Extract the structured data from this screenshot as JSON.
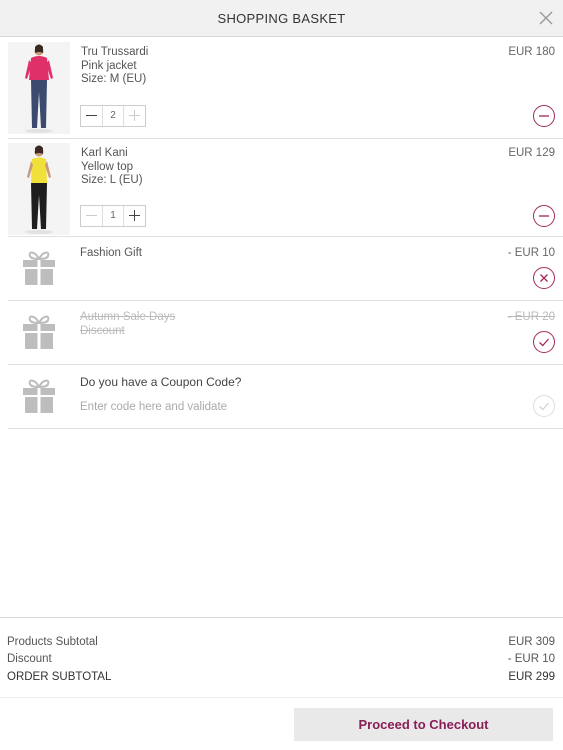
{
  "header": {
    "title": "SHOPPING BASKET"
  },
  "items": [
    {
      "brand": "Tru Trussardi",
      "name": "Pink jacket",
      "size": "Size: M (EU)",
      "price": "EUR 180",
      "quantity": "2",
      "color": "#e0306a"
    },
    {
      "brand": "Karl Kani",
      "name": "Yellow top",
      "size": "Size: L (EU)",
      "price": "EUR 129",
      "quantity": "1",
      "color": "#f2e03a"
    }
  ],
  "promotions": [
    {
      "title": "Fashion Gift",
      "price": "- EUR 10",
      "state": "applied"
    },
    {
      "title": "Autumn Sale Days",
      "subtitle": "Discount",
      "price": "- EUR 20",
      "state": "inactive"
    }
  ],
  "coupon": {
    "question": "Do you have a Coupon Code?",
    "placeholder": "Enter code here and validate",
    "value": ""
  },
  "totals": {
    "products_subtotal_label": "Products Subtotal",
    "products_subtotal_value": "EUR 309",
    "discount_label": "Discount",
    "discount_value": "- EUR 10",
    "order_subtotal_label": "ORDER SUBTOTAL",
    "order_subtotal_value": "EUR 299"
  },
  "footer": {
    "checkout_label": "Proceed to Checkout"
  },
  "colors": {
    "accent": "#8a1e57",
    "circle_accent": "#a0285e",
    "header_bg": "#f1f1f1"
  }
}
